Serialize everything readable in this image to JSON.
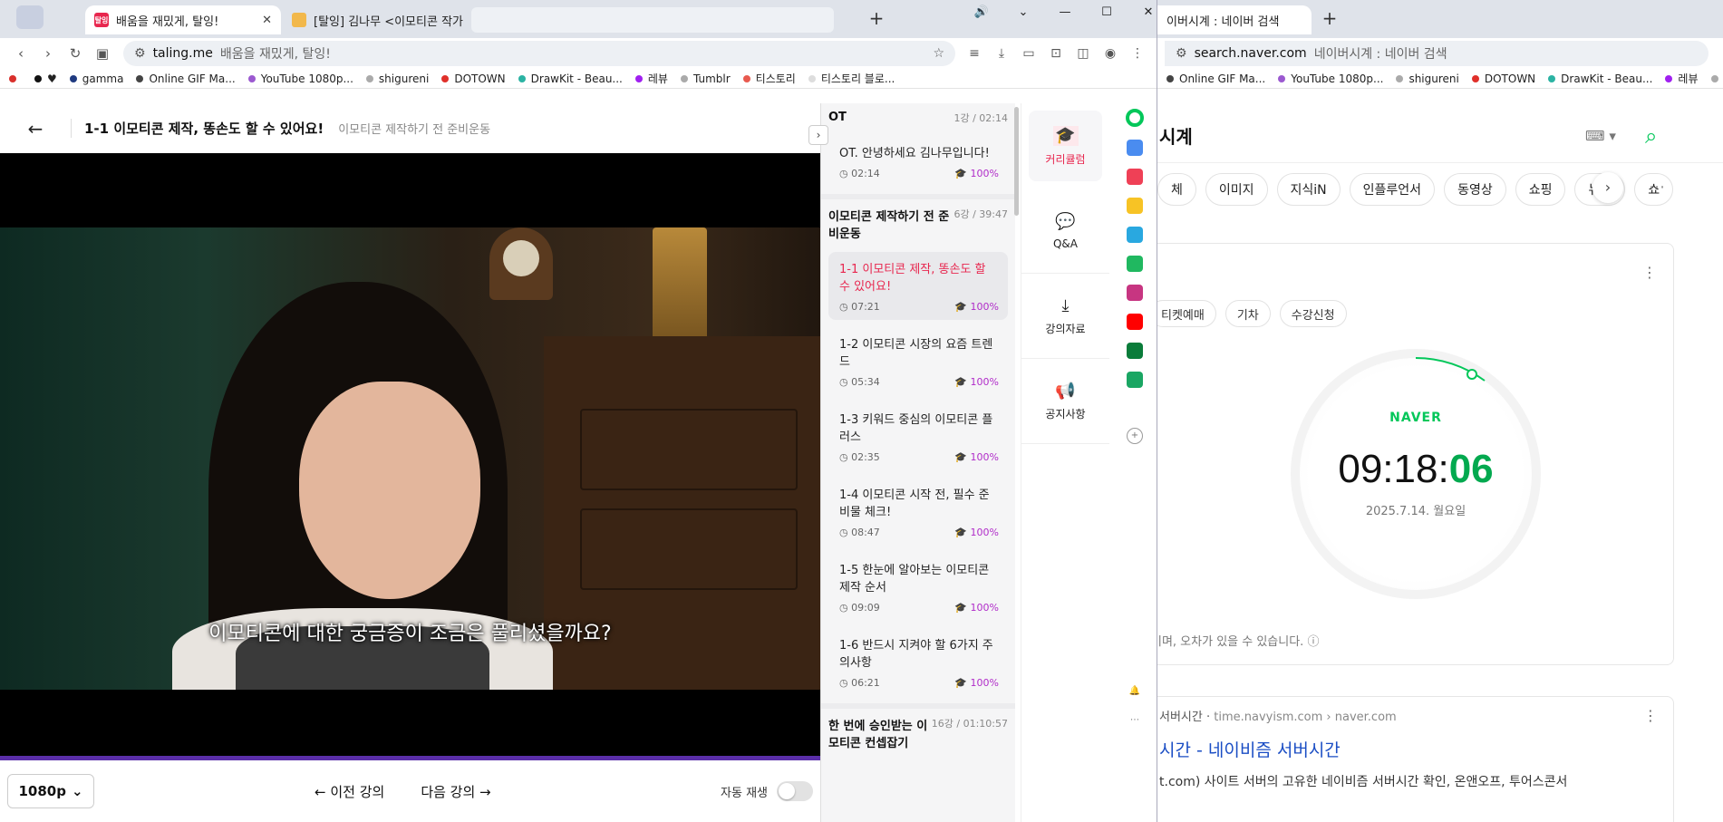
{
  "left_browser": {
    "tabs": [
      {
        "title": "배움을 재밌게, 탈잉!",
        "favicon": "탈잉"
      },
      {
        "title": "[탈잉] 김나무 <이모티콘 작가 데"
      }
    ],
    "window_controls": [
      "🔊",
      "⌄",
      "—",
      "☐",
      "✕"
    ],
    "address": {
      "domain": "taling.me",
      "page_title": "배움을 재밌게, 탈잉!"
    },
    "bookmarks": [
      {
        "label": "",
        "color": "#d9302c"
      },
      {
        "label": "♥",
        "color": "#111111"
      },
      {
        "label": "gamma",
        "color": "#1f3a80"
      },
      {
        "label": "Online GIF Ma...",
        "color": "#444444"
      },
      {
        "label": "YouTube 1080p...",
        "color": "#9b59d0"
      },
      {
        "label": "shigureni",
        "color": "#aaaaaa"
      },
      {
        "label": "DOTOWN",
        "color": "#e0302a"
      },
      {
        "label": "DrawKit - Beau...",
        "color": "#2bb3a3"
      },
      {
        "label": "레뷰",
        "color": "#a020f0"
      },
      {
        "label": "Tumblr",
        "color": "#aaaaaa"
      },
      {
        "label": "티스토리",
        "color": "#e85a4f"
      },
      {
        "label": "티스토리 블로...",
        "color": "#dddddd"
      }
    ]
  },
  "lecture": {
    "title": "1-1 이모티콘 제작, 똥손도 할 수 있어요!",
    "subtitle": "이모티콘 제작하기 전 준비운동",
    "caption": "이모티콘에 대한 궁금증이 조금은 풀리셨을까요?",
    "quality": "1080p",
    "prev_label": "이전 강의",
    "next_label": "다음 강의",
    "autoplay_label": "자동 재생",
    "progress_fraction": 1.0
  },
  "curriculum": {
    "sections": [
      {
        "title": "OT",
        "meta": "1강 / 02:14",
        "lessons": [
          {
            "title": "OT. 안녕하세요 김나무입니다!",
            "duration": "02:14",
            "progress": "100%"
          }
        ]
      },
      {
        "title": "이모티콘 제작하기 전 준비운동",
        "meta": "6강 / 39:47",
        "lessons": [
          {
            "title": "1-1 이모티콘 제작, 똥손도 할 수 있어요!",
            "duration": "07:21",
            "progress": "100%"
          },
          {
            "title": "1-2 이모티콘 시장의 요즘 트렌드",
            "duration": "05:34",
            "progress": "100%"
          },
          {
            "title": "1-3 키워드 중심의 이모티콘 플러스",
            "duration": "02:35",
            "progress": "100%"
          },
          {
            "title": "1-4 이모티콘 시작 전, 필수 준비물 체크!",
            "duration": "08:47",
            "progress": "100%"
          },
          {
            "title": "1-5 한눈에 알아보는 이모티콘 제작 순서",
            "duration": "09:09",
            "progress": "100%"
          },
          {
            "title": "1-6 반드시 지켜야 할 6가지 주의사항",
            "duration": "06:21",
            "progress": "100%"
          }
        ]
      },
      {
        "title": "한 번에 승인받는 이모티콘 컨셉잡기",
        "meta": "16강 / 01:10:57",
        "lessons": []
      }
    ]
  },
  "rail": [
    {
      "label": "커리큘럼",
      "icon": "graduation-cap-icon"
    },
    {
      "label": "Q&A",
      "icon": "chat-bubble-icon"
    },
    {
      "label": "강의자료",
      "icon": "download-icon"
    },
    {
      "label": "공지사항",
      "icon": "megaphone-icon"
    }
  ],
  "right_browser": {
    "tab_title": "이버시계 : 네이버 검색",
    "address": {
      "domain": "search.naver.com",
      "page_title": "네이버시계 : 네이버 검색"
    },
    "bookmarks": [
      {
        "label": "Online GIF Ma...",
        "color": "#444444"
      },
      {
        "label": "YouTube 1080p...",
        "color": "#9b59d0"
      },
      {
        "label": "shigureni",
        "color": "#aaaaaa"
      },
      {
        "label": "DOTOWN",
        "color": "#e0302a"
      },
      {
        "label": "DrawKit - Beau...",
        "color": "#2bb3a3"
      },
      {
        "label": "레뷰",
        "color": "#a020f0"
      },
      {
        "label": "Tumblr",
        "color": "#aaaaaa"
      }
    ]
  },
  "naver": {
    "query": "시계",
    "tabs": [
      "체",
      "이미지",
      "지식iN",
      "인플루언서",
      "동영상",
      "쇼핑",
      "뉴스",
      "쇼"
    ],
    "chips": [
      "티켓예매",
      "기차",
      "수강신청"
    ],
    "logo": "NAVER",
    "time_hm": "09:18:",
    "time_s": "06",
    "date": "2025.7.14. 월요일",
    "disclaimer": "이며, 오차가 있을 수 있습니다.",
    "result": {
      "source_name": "서버시간",
      "source_host": "time.navyism.com › naver.com",
      "title": "시간 - 네이비즘 서버시간",
      "desc": "t.com) 사이트 서버의 고유한 네이비즘 서버시간 확인, 온앤오프, 투어스콘서"
    }
  }
}
